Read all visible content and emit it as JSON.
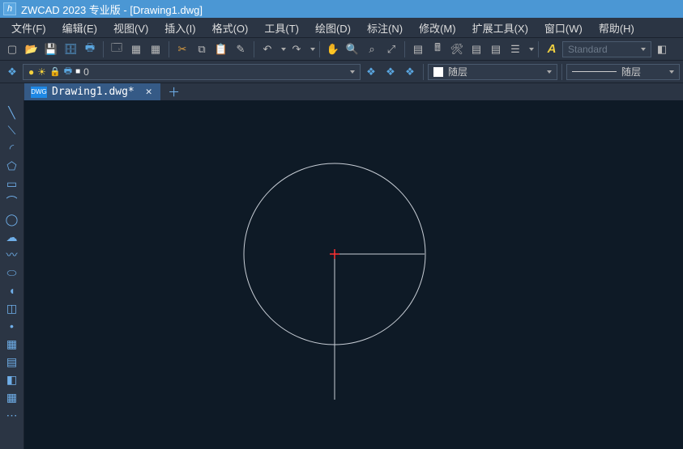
{
  "title": "ZWCAD 2023 专业版 - [Drawing1.dwg]",
  "logo_text": "h",
  "menu": {
    "file": "文件(F)",
    "edit": "编辑(E)",
    "view": "视图(V)",
    "insert": "插入(I)",
    "format": "格式(O)",
    "tools": "工具(T)",
    "draw": "绘图(D)",
    "dimension": "标注(N)",
    "modify": "修改(M)",
    "extended": "扩展工具(X)",
    "window": "窗口(W)",
    "help": "帮助(H)"
  },
  "toolbar": {
    "style_label": "Standard",
    "italic_A": "A",
    "layer_value": "0",
    "bylayer1": "随层",
    "bylayer2": "随层"
  },
  "layer_icons": {
    "bulb": "●",
    "sun": "☀",
    "lock": "🔒",
    "print": "🖶",
    "swatch": "■"
  },
  "doc": {
    "badge": "DWG",
    "tab_name": "Drawing1.dwg*",
    "close": "✕",
    "plus": "＋"
  },
  "side_tools": [
    {
      "name": "line-tool",
      "glyph": "╲"
    },
    {
      "name": "construction-line-tool",
      "glyph": "⟍"
    },
    {
      "name": "arc-tool",
      "glyph": "◜"
    },
    {
      "name": "polygon-tool",
      "glyph": "⬠"
    },
    {
      "name": "rectangle-tool",
      "glyph": "▭"
    },
    {
      "name": "arc2-tool",
      "glyph": "⌒"
    },
    {
      "name": "circle-tool",
      "glyph": "◯"
    },
    {
      "name": "revcloud-tool",
      "glyph": "☁"
    },
    {
      "name": "spline-tool",
      "glyph": "〰"
    },
    {
      "name": "ellipse-tool",
      "glyph": "⬭"
    },
    {
      "name": "ellipse-arc-tool",
      "glyph": "◖"
    },
    {
      "name": "block-tool",
      "glyph": "◫"
    },
    {
      "name": "point-tool",
      "glyph": "•"
    },
    {
      "name": "hatch-tool",
      "glyph": "▦"
    },
    {
      "name": "gradient-tool",
      "glyph": "▤"
    },
    {
      "name": "region-tool",
      "glyph": "◧"
    },
    {
      "name": "table-tool",
      "glyph": "▦"
    },
    {
      "name": "more-tool",
      "glyph": "⋯"
    }
  ],
  "top_icons": {
    "new": "▢",
    "open": "📂",
    "save": "💾",
    "saveall": "🗄",
    "print": "🖶",
    "preview": "🗔",
    "plot": "▦",
    "cut": "✂",
    "copy": "⧉",
    "paste": "📋",
    "match": "✎",
    "undo": "↶",
    "redo": "↷",
    "pan": "✋",
    "zoomrt": "🔍",
    "zoomwin": "⌕",
    "zoomext": "⤢",
    "prop": "▤",
    "calc": "🖩",
    "tool": "🛠",
    "layer": "☰"
  }
}
